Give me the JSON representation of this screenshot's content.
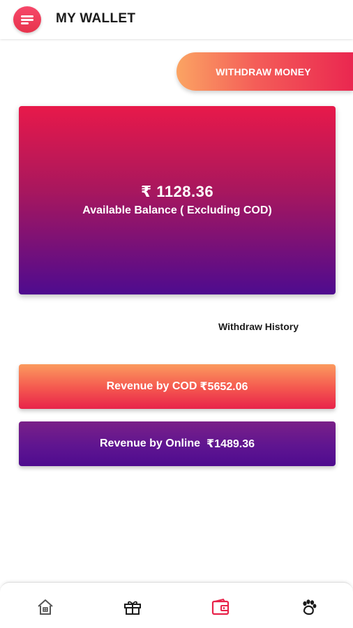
{
  "header": {
    "title": "MY WALLET",
    "menu_icon": "hamburger-menu-icon",
    "menu_color": "#ea3650"
  },
  "actions": {
    "withdraw_money_label": "WITHDRAW MONEY"
  },
  "balance": {
    "amount": "₹ 1128.36",
    "label": "Available Balance ( Excluding COD)"
  },
  "withdraw_history_label": "Withdraw History",
  "revenue": {
    "cod_label": "Revenue by COD",
    "cod_value": "₹5652.06",
    "online_label": "Revenue by Online",
    "online_value": "₹1489.36"
  },
  "bottom_nav": {
    "items": [
      {
        "icon": "home-icon",
        "active": false
      },
      {
        "icon": "gift-icon",
        "active": false
      },
      {
        "icon": "wallet-icon",
        "active": true
      },
      {
        "icon": "paw-icon",
        "active": false
      }
    ],
    "active_color": "#e8234a",
    "inactive_color": "#1b1b1b"
  },
  "colors": {
    "accent": "#e8234a",
    "purple": "#4e0b8f",
    "orange": "#fba463"
  }
}
